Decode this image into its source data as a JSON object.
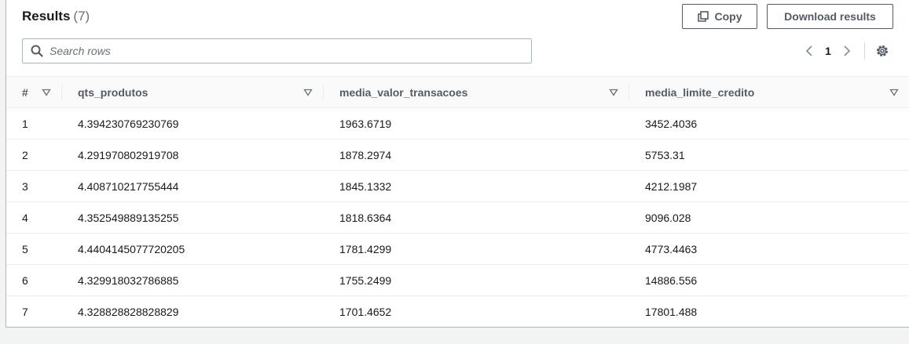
{
  "header": {
    "title": "Results",
    "count": "(7)",
    "copy_label": "Copy",
    "download_label": "Download results"
  },
  "search": {
    "placeholder": "Search rows",
    "value": ""
  },
  "pagination": {
    "current_page": "1"
  },
  "icons": {
    "copy": "copy-icon",
    "search": "search-icon",
    "prev": "chevron-left-icon",
    "next": "chevron-right-icon",
    "settings": "gear-icon",
    "sort": "sort-caret-icon"
  },
  "table": {
    "columns": [
      "#",
      "qts_produtos",
      "media_valor_transacoes",
      "media_limite_credito"
    ],
    "rows": [
      [
        "1",
        "4.394230769230769",
        "1963.6719",
        "3452.4036"
      ],
      [
        "2",
        "4.291970802919708",
        "1878.2974",
        "5753.31"
      ],
      [
        "3",
        "4.408710217755444",
        "1845.1332",
        "4212.1987"
      ],
      [
        "4",
        "4.352549889135255",
        "1818.6364",
        "9096.028"
      ],
      [
        "5",
        "4.4404145077720205",
        "1781.4299",
        "4773.4463"
      ],
      [
        "6",
        "4.329918032786885",
        "1755.2499",
        "14886.556"
      ],
      [
        "7",
        "4.328828828828829",
        "1701.4652",
        "17801.488"
      ]
    ]
  },
  "colors": {
    "text": "#16191f",
    "muted": "#687078",
    "border": "#aab7b8",
    "header_bg": "#fafafa",
    "button_text": "#545b64"
  }
}
